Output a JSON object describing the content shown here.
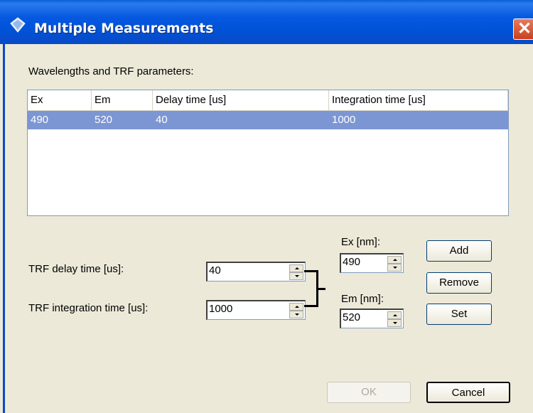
{
  "window": {
    "title": "Multiple Measurements",
    "close_symbol": "✕"
  },
  "wavelengths_label": "Wavelengths and TRF parameters:",
  "table": {
    "columns": [
      "Ex",
      "Em",
      "Delay time [us]",
      "Integration time [us]"
    ],
    "rows": [
      {
        "ex": "490",
        "em": "520",
        "delay": "40",
        "integration": "1000",
        "selected": true
      }
    ]
  },
  "trf": {
    "delay_label": "TRF delay time [us]:",
    "delay_value": "40",
    "integration_label": "TRF integration time [us]:",
    "integration_value": "1000"
  },
  "ex": {
    "label": "Ex [nm]:",
    "value": "490"
  },
  "em": {
    "label": "Em [nm]:",
    "value": "520"
  },
  "buttons": {
    "add": "Add",
    "remove": "Remove",
    "set": "Set",
    "ok": "OK",
    "cancel": "Cancel"
  },
  "colors": {
    "titlebar": "#0558e0",
    "selection": "#7c96d3",
    "dialog_bg": "#ece9d8"
  }
}
